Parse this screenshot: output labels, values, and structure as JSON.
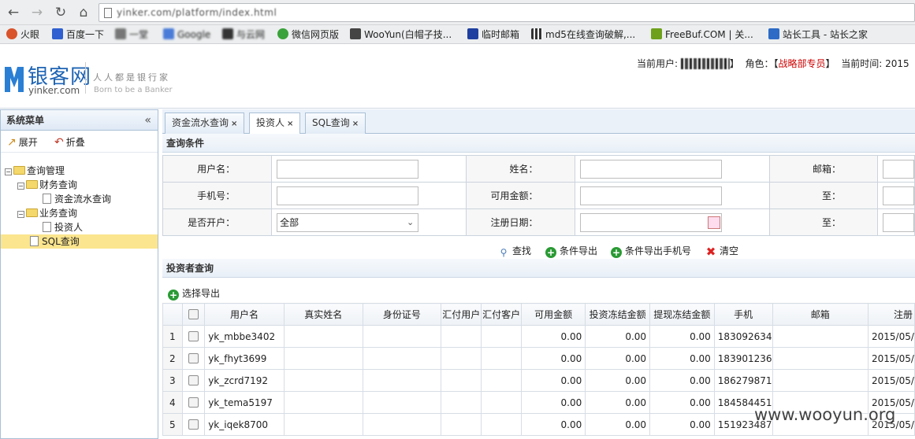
{
  "browser": {
    "url": "yinker.com/platform/index.html",
    "bookmarks": [
      {
        "label": "火眼",
        "color": "#d9532b"
      },
      {
        "label": "百度一下",
        "color": "#2f5fd0"
      },
      {
        "label": "一堂",
        "color": "#777777"
      },
      {
        "label": "Google",
        "color": "#4a7bd8"
      },
      {
        "label": "与云网",
        "color": "#333333"
      },
      {
        "label": "微信网页版",
        "color": "#3aa23a"
      },
      {
        "label": "WooYun(白帽子技...",
        "color": "#444444"
      },
      {
        "label": "临时邮箱",
        "color": "#1f3fa0"
      },
      {
        "label": "md5在线查询破解,...",
        "color": "#333333"
      },
      {
        "label": "FreeBuf.COM | 关...",
        "color": "#6ea01c"
      },
      {
        "label": "站长工具 - 站长之家",
        "color": "#2d6bc6"
      }
    ]
  },
  "header": {
    "logo_cn": "银客网",
    "logo_en": "yinker.com",
    "slogan": "人人都是银行家",
    "slogan_en": "Born to be a Banker",
    "current_user_label": "当前用户:",
    "role_label": "角色：【",
    "role": "战略部专员",
    "role_close": "】",
    "time_label": "当前时间:",
    "time_value": "2015"
  },
  "sidebar": {
    "title": "系统菜单",
    "expand": "展开",
    "collapse": "折叠",
    "tree": {
      "root": "查询管理",
      "finance": "财务查询",
      "fund_flow": "资金流水查询",
      "business": "业务查询",
      "investor": "投资人",
      "sql": "SQL查询"
    }
  },
  "tabs": [
    {
      "label": "资金流水查询"
    },
    {
      "label": "投资人"
    },
    {
      "label": "SQL查询"
    }
  ],
  "query": {
    "title": "查询条件",
    "username_label": "用户名：",
    "name_label": "姓名：",
    "email_label": "邮箱：",
    "phone_label": "手机号：",
    "balance_label": "可用金额：",
    "to_label": "至：",
    "opened_label": "是否开户：",
    "opened_value": "全部",
    "regdate_label": "注册日期：",
    "to_label2": "至："
  },
  "actions": {
    "search": "查找",
    "export": "条件导出",
    "export_phone": "条件导出手机号",
    "clear": "清空"
  },
  "results": {
    "title": "投资者查询",
    "select_export": "选择导出",
    "columns": [
      "用户名",
      "真实姓名",
      "身份证号",
      "汇付用户",
      "汇付客户",
      "可用金额",
      "投资冻结金额",
      "提现冻结金额",
      "手机",
      "邮箱",
      "注册"
    ],
    "rows": [
      {
        "n": "1",
        "user": "yk_mbbe3402",
        "avail": "0.00",
        "inv": "0.00",
        "wd": "0.00",
        "phone": "183092634",
        "reg": "2015/05/"
      },
      {
        "n": "2",
        "user": "yk_fhyt3699",
        "avail": "0.00",
        "inv": "0.00",
        "wd": "0.00",
        "phone": "183901236",
        "reg": "2015/05/"
      },
      {
        "n": "3",
        "user": "yk_zcrd7192",
        "avail": "0.00",
        "inv": "0.00",
        "wd": "0.00",
        "phone": "186279871",
        "reg": "2015/05/"
      },
      {
        "n": "4",
        "user": "yk_tema5197",
        "avail": "0.00",
        "inv": "0.00",
        "wd": "0.00",
        "phone": "184584451",
        "reg": "2015/05/"
      },
      {
        "n": "5",
        "user": "yk_iqek8700",
        "avail": "0.00",
        "inv": "0.00",
        "wd": "0.00",
        "phone": "151923487",
        "reg": "2015/05/"
      }
    ]
  },
  "watermark": "www.wooyun.org"
}
